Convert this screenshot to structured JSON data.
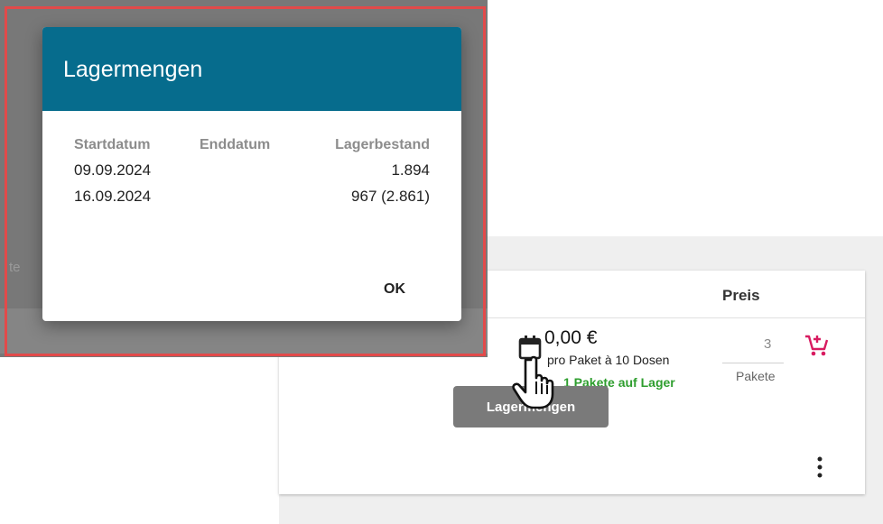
{
  "dialog": {
    "title": "Lagermengen",
    "columns": [
      "Startdatum",
      "Enddatum",
      "Lagerbestand"
    ],
    "rows": [
      {
        "start": "09.09.2024",
        "end": "",
        "stock": "1.894"
      },
      {
        "start": "16.09.2024",
        "end": "",
        "stock": "967 (2.861)"
      }
    ],
    "ok_label": "OK"
  },
  "background": {
    "ghost_text": "te"
  },
  "product": {
    "preis_header": "Preis",
    "price": "0,00 €",
    "price_sub": "pro Paket à 10 Dosen",
    "stock_text": "1 Pakete auf Lager",
    "quantity_value": "3",
    "quantity_unit": "Pakete",
    "tooltip": "Lagermengen"
  },
  "colors": {
    "dialog_header": "#066c8d",
    "stock_green": "#2e9e2e",
    "cart_red": "#d81b60",
    "focus_outline": "#e24a4a"
  },
  "icons": {
    "calendar": "calendar-icon",
    "cart": "add-to-cart-icon",
    "more": "more-vert-icon",
    "cursor": "hand-pointer-cursor"
  }
}
